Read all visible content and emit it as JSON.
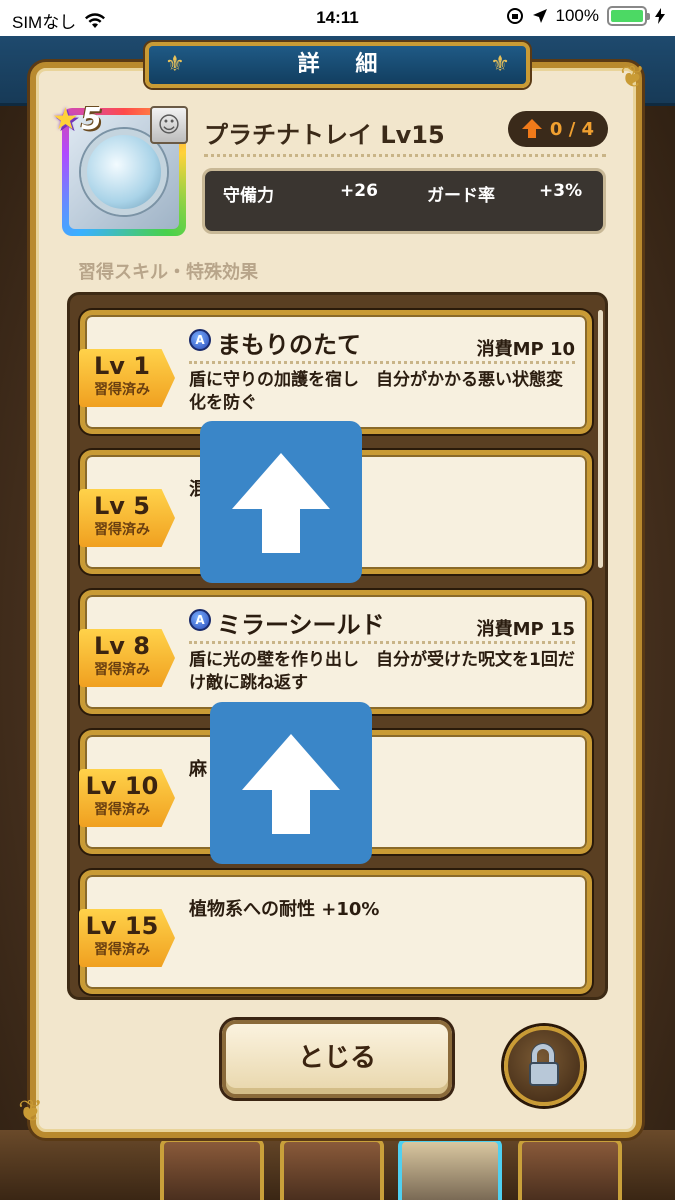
{
  "status_bar": {
    "carrier": "SIMなし",
    "time": "14:11",
    "battery": "100%"
  },
  "dialog": {
    "title": "詳 細",
    "close_label": "とじる"
  },
  "equipment": {
    "rank": "5",
    "name": "プラチナトレイ Lv15",
    "upgrade_count": "0 / 4",
    "stats": [
      {
        "label": "守備力",
        "value": "+26"
      },
      {
        "label": "ガード率",
        "value": "+3%"
      }
    ]
  },
  "section_title": "習得スキル・特殊効果",
  "skills": [
    {
      "lv": "Lv 1",
      "status": "習得済み",
      "type": "skill",
      "name": "まもりのたて",
      "mp": "消費MP 10",
      "desc": "盾に守りの加護を宿し　自分がかかる悪い状態変化を防ぐ"
    },
    {
      "lv": "Lv 5",
      "status": "習得済み",
      "type": "effect",
      "text": "混"
    },
    {
      "lv": "Lv 8",
      "status": "習得済み",
      "type": "skill",
      "name": "ミラーシールド",
      "mp": "消費MP 15",
      "desc": "盾に光の壁を作り出し　自分が受けた呪文を1回だけ敵に跳ね返す"
    },
    {
      "lv": "Lv 10",
      "status": "習得済み",
      "type": "effect",
      "text": "麻"
    },
    {
      "lv": "Lv 15",
      "status": "習得済み",
      "type": "effect",
      "text": "植物系への耐性 +10%"
    }
  ],
  "icons": {
    "skill_marker": "A",
    "rank_star": "★",
    "char_face": "☺"
  }
}
